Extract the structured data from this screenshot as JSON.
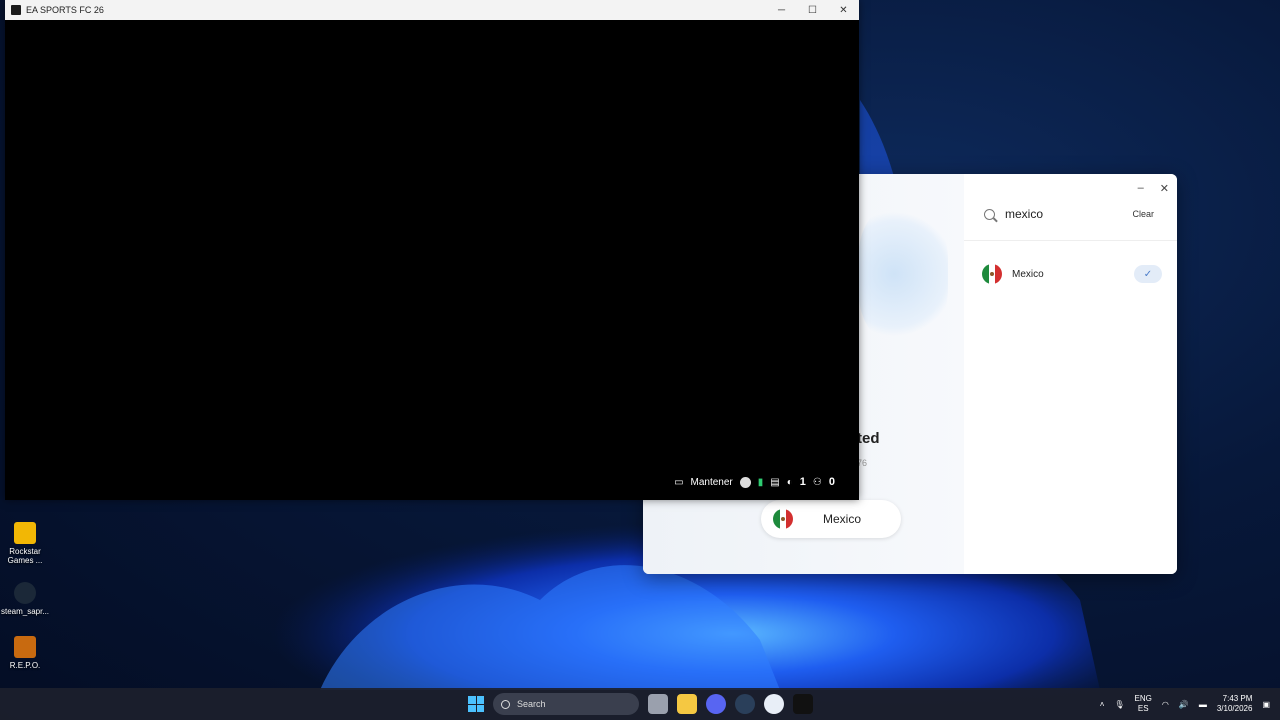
{
  "game_window": {
    "title": "EA SPORTS FC 26",
    "controls": {
      "minimize": "─",
      "maximize": "☐",
      "close": "✕"
    },
    "overlay": {
      "label": "Mantener",
      "count_a": "1",
      "count_b": "0"
    }
  },
  "vpn_window": {
    "status_text": "ted",
    "ip_fragment": "76",
    "location_button": "Mexico",
    "controls": {
      "minimize": "–",
      "close": "✕"
    },
    "search": {
      "value": "mexico",
      "clear_label": "Clear"
    },
    "results": [
      {
        "label": "Mexico",
        "selected": true
      }
    ]
  },
  "desktop_icons": [
    {
      "label": "Rockstar Games ...",
      "icon": "rockstar-icon"
    },
    {
      "label": "steam_sapr...",
      "icon": "steam-icon"
    },
    {
      "label": "R.E.P.O.",
      "icon": "repo-icon"
    }
  ],
  "taskbar": {
    "search_label": "Search",
    "language_top": "ENG",
    "language_bottom": "ES",
    "time": "7:43 PM",
    "date": "3/10/2026"
  },
  "colors": {
    "accent": "#4cc2ff",
    "selected_bg": "#e3ecf8"
  }
}
